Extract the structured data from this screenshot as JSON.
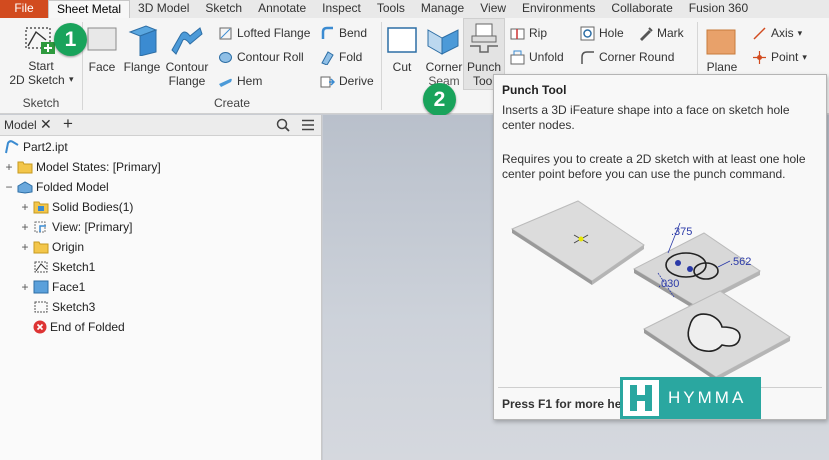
{
  "tabs": [
    "File",
    "Sheet Metal",
    "3D Model",
    "Sketch",
    "Annotate",
    "Inspect",
    "Tools",
    "Manage",
    "View",
    "Environments",
    "Collaborate",
    "Fusion 360"
  ],
  "ribbon": {
    "sketch_panel": {
      "start_line1": "Start",
      "start_line2": "2D Sketch",
      "title": "Sketch"
    },
    "create_panel": {
      "face": "Face",
      "flange": "Flange",
      "contour1": "Contour",
      "contour2": "Flange",
      "lofted_flange": "Lofted Flange",
      "contour_roll": "Contour Roll",
      "hem": "Hem",
      "bend": "Bend",
      "fold": "Fold",
      "derive": "Derive",
      "title": "Create"
    },
    "modify_panel": {
      "cut": "Cut",
      "corner1": "Corner",
      "corner2": "Seam",
      "punch1": "Punch",
      "punch2": "Tool",
      "rip": "Rip",
      "unfold": "Unfold",
      "hole": "Hole",
      "corner_round": "Corner Round",
      "mark": "Mark"
    },
    "plane": "Plane",
    "axis": "Axis",
    "point": "Point"
  },
  "badges": {
    "one": "1",
    "two": "2"
  },
  "browser": {
    "tab_label": "Model",
    "tree": [
      {
        "label": "Part2.ipt"
      },
      {
        "label": "Model States: [Primary]"
      },
      {
        "label": "Folded Model"
      },
      {
        "label": "Solid Bodies(1)"
      },
      {
        "label": "View: [Primary]"
      },
      {
        "label": "Origin"
      },
      {
        "label": "Sketch1"
      },
      {
        "label": "Face1"
      },
      {
        "label": "Sketch3"
      },
      {
        "label": "End of Folded"
      }
    ]
  },
  "tooltip": {
    "title": "Punch Tool",
    "desc1": "Inserts a 3D iFeature shape into a face on sketch hole center nodes.",
    "desc2": "Requires you to create a 2D sketch with at least one hole center point before you can use the punch command.",
    "dims": {
      "d1": ".375",
      "d2": ".562",
      "d3": ".030"
    },
    "footer": "Press F1 for more hel"
  },
  "watermark": "HYMMA",
  "colors": {
    "file_tab": "#d24b1f",
    "badge": "#19a35b",
    "watermark": "#2aa7a0"
  }
}
